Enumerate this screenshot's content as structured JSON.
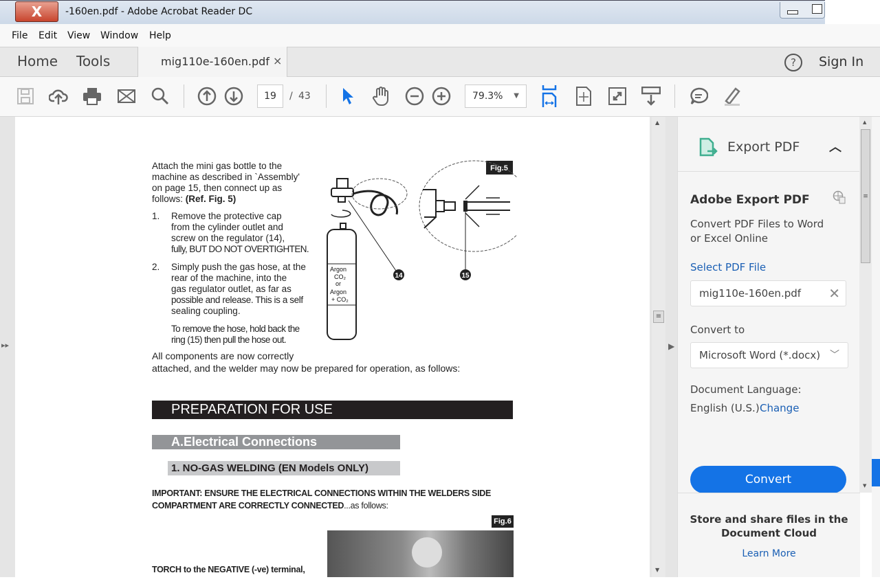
{
  "window": {
    "title": "-160en.pdf - Adobe Acrobat Reader DC",
    "close": "X"
  },
  "menu": [
    "File",
    "Edit",
    "View",
    "Window",
    "Help"
  ],
  "tabs": {
    "home": "Home",
    "tools": "Tools",
    "document": "mig110e-160en.pdf",
    "close": "×",
    "sign_in": "Sign In",
    "help": "?"
  },
  "toolbar": {
    "page_current": "19",
    "page_sep": "/",
    "page_total": "43",
    "zoom": "79.3%"
  },
  "colors": {
    "accent": "#1473e6",
    "export_icon": "#3fae8f"
  },
  "document": {
    "intro": [
      "Attach the mini gas bottle to the",
      "machine as described in `Assembly'",
      "on page 15, then connect up as",
      "follows: "
    ],
    "intro_ref": "(Ref. Fig. 5)",
    "step1_num": "1.",
    "step1": [
      "Remove the protective cap",
      "from the cylinder outlet and",
      "screw on the regulator (14),",
      "fully, BUT DO NOT OVERTIGHTEN."
    ],
    "step2_num": "2.",
    "step2": [
      "Simply push the gas hose, at the",
      "rear of the machine, into the",
      "gas regulator outlet, as far as",
      "possible and release. This is a self",
      "sealing coupling."
    ],
    "step2_note": [
      "To remove the hose, hold back the",
      "ring (15) then pull the hose out."
    ],
    "conclusion": [
      "All components are now correctly",
      "attached, and the welder may now be prepared for operation, as follows:"
    ],
    "fig5": {
      "label": "Fig.5",
      "callout_14": "14",
      "callout_15": "15",
      "bottle_text": [
        "Argon",
        "CO₂",
        "or",
        "Argon",
        "+ CO₂"
      ]
    },
    "heading_main": "PREPARATION FOR USE",
    "heading_a": "A.Electrical Connections",
    "heading_1": "1. NO-GAS WELDING (EN Models ONLY)",
    "important_bold": [
      "IMPORTANT: ENSURE THE ELECTRICAL CONNECTIONS WITHIN THE WELDERS SIDE",
      "COMPARTMENT ARE CORRECTLY CONNECTED"
    ],
    "important_tail": "...as follows:",
    "fig6_label": "Fig.6",
    "torch": "TORCH to the NEGATIVE (-ve) terminal,"
  },
  "panel": {
    "header": "Export PDF",
    "title": "Adobe Export PDF",
    "desc": [
      "Convert PDF Files to Word",
      "or Excel Online"
    ],
    "select_label": "Select PDF File",
    "file": "mig110e-160en.pdf",
    "convert_to_label": "Convert to",
    "convert_to": "Microsoft Word (*.docx)",
    "lang_label": "Document Language:",
    "lang": "English (U.S.)",
    "change": "Change",
    "convert_btn": "Convert",
    "store": [
      "Store and share files in the",
      "Document Cloud"
    ],
    "learn_more": "Learn More"
  }
}
